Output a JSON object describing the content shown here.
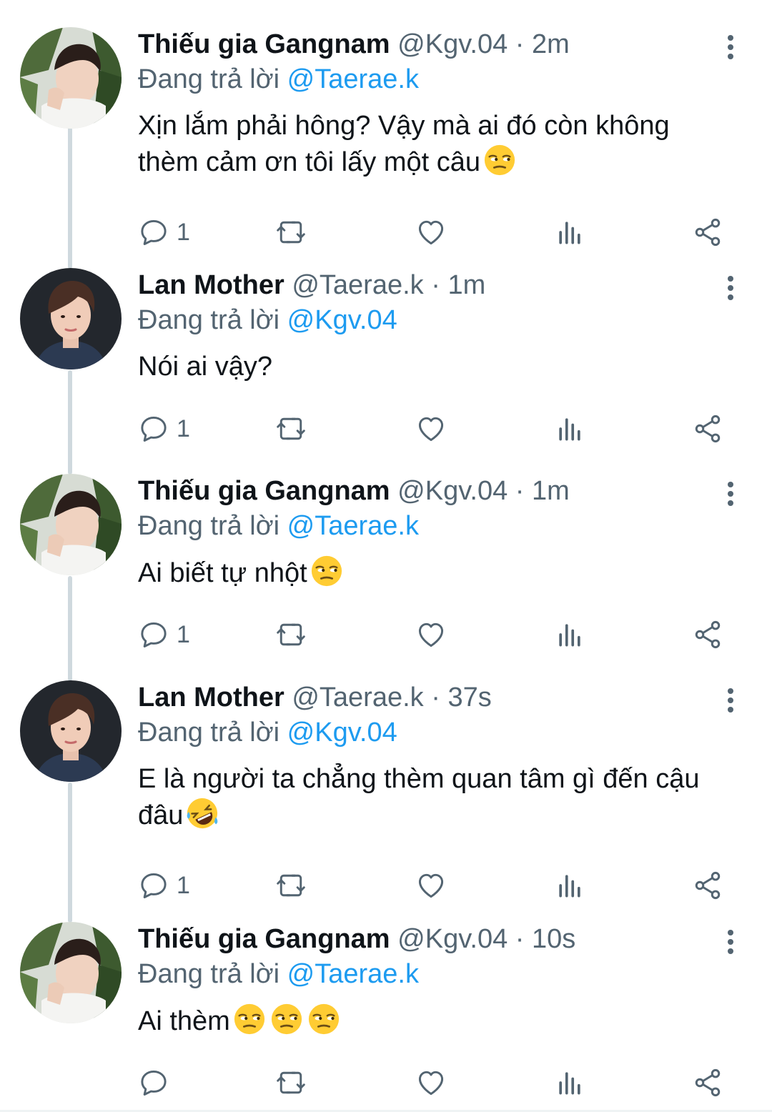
{
  "colors": {
    "accent": "#1d9bf0",
    "muted": "#536471",
    "text": "#0f1419",
    "thread_line": "#cfd9de"
  },
  "tweets": [
    {
      "author": "Thiếu gia Gangnam",
      "handle": "@Kgv.04",
      "time": "2m",
      "reply_prefix": "Đang trả lời",
      "reply_to": "@Taerae.k",
      "text": "Xịn lắm phải hông? Vậy mà ai đó còn không thèm cảm ơn tôi lấy một câu",
      "emojis": [
        "unamused-emoji"
      ],
      "reply_count": "1",
      "avatar": "gangnam-avatar"
    },
    {
      "author": "Lan Mother",
      "handle": "@Taerae.k",
      "time": "1m",
      "reply_prefix": "Đang trả lời",
      "reply_to": "@Kgv.04",
      "text": "Nói ai vậy?",
      "emojis": [],
      "reply_count": "1",
      "avatar": "lan-avatar"
    },
    {
      "author": "Thiếu gia Gangnam",
      "handle": "@Kgv.04",
      "time": "1m",
      "reply_prefix": "Đang trả lời",
      "reply_to": "@Taerae.k",
      "text": "Ai biết tự nhột",
      "emojis": [
        "unamused-emoji"
      ],
      "reply_count": "1",
      "avatar": "gangnam-avatar"
    },
    {
      "author": "Lan Mother",
      "handle": "@Taerae.k",
      "time": "37s",
      "reply_prefix": "Đang trả lời",
      "reply_to": "@Kgv.04",
      "text": "E là người ta chẳng thèm quan tâm gì đến cậu đâu",
      "emojis": [
        "rolling-laughing-emoji"
      ],
      "reply_count": "1",
      "avatar": "lan-avatar"
    },
    {
      "author": "Thiếu gia Gangnam",
      "handle": "@Kgv.04",
      "time": "10s",
      "reply_prefix": "Đang trả lời",
      "reply_to": "@Taerae.k",
      "text": "Ai thèm",
      "emojis": [
        "unamused-emoji",
        "unamused-emoji",
        "unamused-emoji"
      ],
      "reply_count": "",
      "avatar": "gangnam-avatar"
    }
  ]
}
